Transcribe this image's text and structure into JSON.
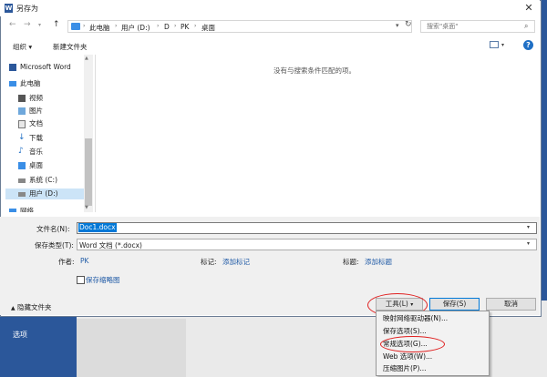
{
  "app": {
    "title": "另存为",
    "word_icon": "W"
  },
  "background": {
    "options_label": "选项"
  },
  "nav": {
    "back_icon": "←",
    "forward_icon": "→",
    "up_icon": "↑",
    "breadcrumb": [
      "此电脑",
      "用户 (D:)",
      "D",
      "PK",
      "桌面"
    ],
    "search_placeholder": "搜索\"桌面\""
  },
  "toolbar": {
    "organize": "组织 ▾",
    "new_folder": "新建文件夹"
  },
  "sidebar": {
    "items": [
      {
        "label": "Microsoft Word",
        "icon": "word-icon"
      },
      {
        "label": "此电脑",
        "icon": "computer-icon"
      },
      {
        "label": "视频",
        "icon": "video-icon"
      },
      {
        "label": "图片",
        "icon": "picture-icon"
      },
      {
        "label": "文档",
        "icon": "document-icon"
      },
      {
        "label": "下载",
        "icon": "download-icon"
      },
      {
        "label": "音乐",
        "icon": "music-icon"
      },
      {
        "label": "桌面",
        "icon": "desktop-icon"
      },
      {
        "label": "系统 (C:)",
        "icon": "drive-icon"
      },
      {
        "label": "用户 (D:)",
        "icon": "drive-icon"
      },
      {
        "label": "网络",
        "icon": "network-icon"
      }
    ]
  },
  "main": {
    "empty_message": "没有与搜索条件匹配的项。"
  },
  "form": {
    "filename_label": "文件名(N):",
    "filename_value": "Doc1.docx",
    "type_label": "保存类型(T):",
    "type_value": "Word 文档 (*.docx)",
    "author_label": "作者:",
    "author_value": "PK",
    "tags_label": "标记:",
    "tags_value": "添加标记",
    "title_label": "标题:",
    "title_value": "添加标题",
    "thumbnail_label": "保存缩略图",
    "hide_folders": "隐藏文件夹"
  },
  "buttons": {
    "tools": "工具(L)",
    "save": "保存(S)",
    "cancel": "取消"
  },
  "tools_menu": {
    "items": [
      "映射网络驱动器(N)...",
      "保存选项(S)...",
      "常规选项(G)...",
      "Web 选项(W)...",
      "压缩图片(P)..."
    ]
  },
  "colors": {
    "accent": "#0078d7",
    "word_blue": "#2b579a",
    "highlight_red": "#e02020"
  }
}
